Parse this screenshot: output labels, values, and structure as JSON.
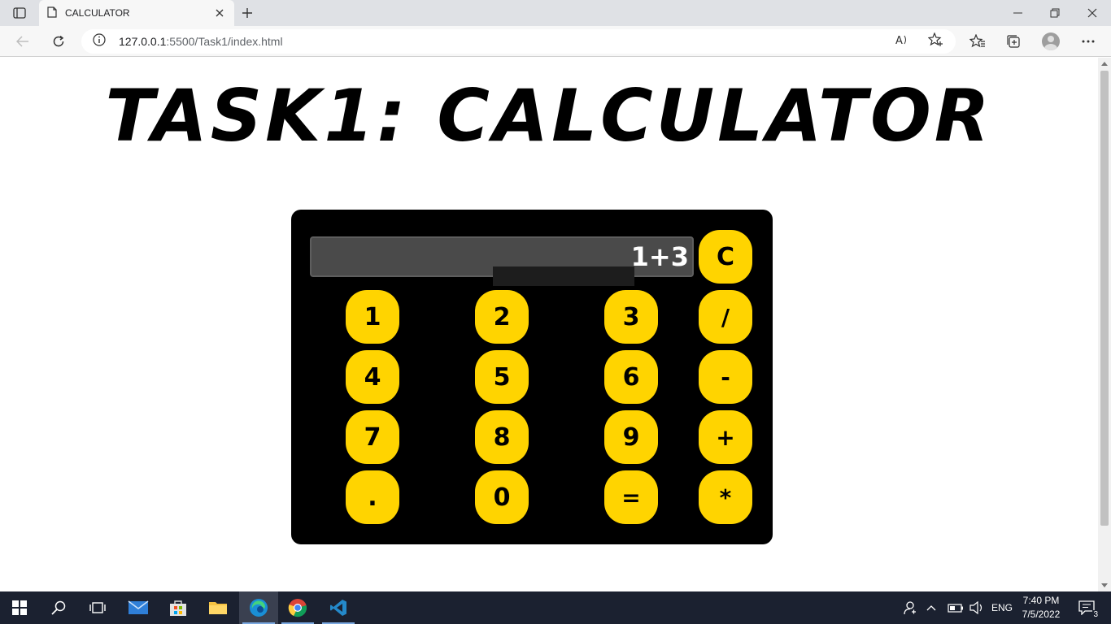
{
  "browser": {
    "tab_title": "CALCULATOR",
    "url_host": "127.0.0.1",
    "url_path": ":5500/Task1/index.html"
  },
  "page": {
    "title": "TASK1: CALCULATOR"
  },
  "calculator": {
    "display_value": "1+3",
    "keys": {
      "clear": "C",
      "one": "1",
      "two": "2",
      "three": "3",
      "divide": "/",
      "four": "4",
      "five": "5",
      "six": "6",
      "minus": "-",
      "seven": "7",
      "eight": "8",
      "nine": "9",
      "plus": "+",
      "dot": ".",
      "zero": "0",
      "equals": "=",
      "multiply": "*"
    },
    "key_color": "#ffd400",
    "body_color": "#000000"
  },
  "taskbar": {
    "language": "ENG",
    "time": "7:40 PM",
    "date": "7/5/2022",
    "notification_count": "3"
  }
}
